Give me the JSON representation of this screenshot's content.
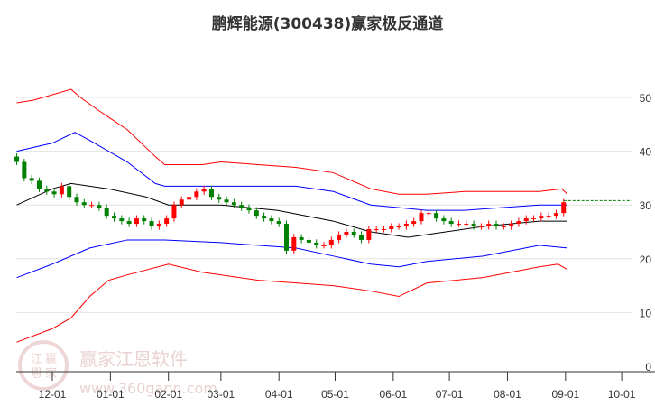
{
  "chart_data": {
    "type": "candlestick-band",
    "title": "鹏辉能源(300438)赢家极反通道",
    "ylim": [
      0,
      55
    ],
    "yticks": [
      0,
      10,
      20,
      30,
      40,
      50
    ],
    "xticks": [
      {
        "label": "12-01",
        "day": 0
      },
      {
        "label": "01-01",
        "day": 31
      },
      {
        "label": "02-01",
        "day": 62
      },
      {
        "label": "03-01",
        "day": 90
      },
      {
        "label": "04-01",
        "day": 121
      },
      {
        "label": "05-01",
        "day": 151
      },
      {
        "label": "06-01",
        "day": 182
      },
      {
        "label": "07-01",
        "day": 212
      },
      {
        "label": "08-01",
        "day": 243
      },
      {
        "label": "09-01",
        "day": 274
      },
      {
        "label": "10-01",
        "day": 304
      }
    ],
    "xrange_days": [
      -19,
      320
    ],
    "series": [
      {
        "name": "outer-upper",
        "color": "#ff0000",
        "points": [
          [
            -19,
            49
          ],
          [
            -10,
            49.5
          ],
          [
            0,
            50.5
          ],
          [
            10,
            51.5
          ],
          [
            15,
            50
          ],
          [
            25,
            47.5
          ],
          [
            40,
            44
          ],
          [
            55,
            39
          ],
          [
            60,
            37.5
          ],
          [
            80,
            37.5
          ],
          [
            90,
            38
          ],
          [
            110,
            37.5
          ],
          [
            130,
            37
          ],
          [
            150,
            36
          ],
          [
            170,
            33
          ],
          [
            185,
            32
          ],
          [
            200,
            32
          ],
          [
            220,
            32.5
          ],
          [
            240,
            32.5
          ],
          [
            260,
            32.5
          ],
          [
            272,
            33
          ],
          [
            275,
            32
          ]
        ]
      },
      {
        "name": "inner-upper",
        "color": "#0000ff",
        "points": [
          [
            -19,
            40
          ],
          [
            0,
            41.5
          ],
          [
            12,
            43.5
          ],
          [
            20,
            42
          ],
          [
            40,
            38
          ],
          [
            55,
            34
          ],
          [
            60,
            33.5
          ],
          [
            90,
            33.5
          ],
          [
            130,
            33.5
          ],
          [
            150,
            32.5
          ],
          [
            170,
            30
          ],
          [
            185,
            29.5
          ],
          [
            200,
            29
          ],
          [
            220,
            29
          ],
          [
            240,
            29.5
          ],
          [
            260,
            30
          ],
          [
            275,
            30
          ]
        ]
      },
      {
        "name": "middle",
        "color": "#000000",
        "points": [
          [
            -19,
            30
          ],
          [
            0,
            33
          ],
          [
            10,
            34
          ],
          [
            30,
            33
          ],
          [
            50,
            31.5
          ],
          [
            62,
            30
          ],
          [
            90,
            30
          ],
          [
            120,
            29
          ],
          [
            150,
            27
          ],
          [
            170,
            25
          ],
          [
            190,
            24
          ],
          [
            200,
            24.5
          ],
          [
            230,
            26
          ],
          [
            260,
            27
          ],
          [
            275,
            27
          ]
        ]
      },
      {
        "name": "inner-lower",
        "color": "#0000ff",
        "points": [
          [
            -19,
            16.5
          ],
          [
            0,
            19
          ],
          [
            20,
            22
          ],
          [
            40,
            23.5
          ],
          [
            60,
            23.5
          ],
          [
            90,
            23
          ],
          [
            130,
            22
          ],
          [
            150,
            20.5
          ],
          [
            170,
            19
          ],
          [
            185,
            18.5
          ],
          [
            200,
            19.5
          ],
          [
            230,
            20.5
          ],
          [
            260,
            22.5
          ],
          [
            275,
            22
          ]
        ]
      },
      {
        "name": "outer-lower",
        "color": "#ff0000",
        "points": [
          [
            -19,
            4.5
          ],
          [
            0,
            7
          ],
          [
            10,
            9
          ],
          [
            20,
            13
          ],
          [
            30,
            16
          ],
          [
            40,
            17
          ],
          [
            62,
            19
          ],
          [
            80,
            17.5
          ],
          [
            110,
            16
          ],
          [
            130,
            15.5
          ],
          [
            150,
            15
          ],
          [
            170,
            14
          ],
          [
            185,
            13
          ],
          [
            200,
            15.5
          ],
          [
            230,
            16.5
          ],
          [
            260,
            18.5
          ],
          [
            270,
            19
          ],
          [
            275,
            18
          ]
        ]
      }
    ],
    "candles": {
      "start_day": -19,
      "step_days": 4,
      "first_open": 39,
      "closes": [
        38,
        35,
        34.5,
        33,
        32.5,
        32,
        33.5,
        31.5,
        30.5,
        30,
        30,
        29.5,
        28,
        27.5,
        27,
        26.5,
        27.5,
        27,
        26,
        26.5,
        27.5,
        30,
        31,
        31.5,
        32.5,
        33,
        31.5,
        31,
        30.5,
        30,
        29.5,
        29,
        28,
        27.5,
        27,
        26.5,
        21.5,
        24,
        23.5,
        23,
        22.5,
        22.5,
        23.5,
        24.5,
        25,
        24.5,
        23.5,
        25.5,
        25.5,
        25.5,
        26,
        26,
        26.5,
        27,
        28.5,
        28.5,
        27.5,
        27,
        26.5,
        26.5,
        26.5,
        26,
        26,
        26.5,
        26,
        26,
        26.5,
        27,
        27.5,
        27.5,
        28,
        28,
        28.5,
        30.5
      ]
    },
    "up_color": "#ff0000",
    "down_color": "#008000",
    "last_price": 30.8
  },
  "watermark": {
    "brand": "赢家江恩软件",
    "url": "www.360gann.com",
    "seal": [
      "江",
      "赢",
      "恩",
      "家"
    ]
  }
}
